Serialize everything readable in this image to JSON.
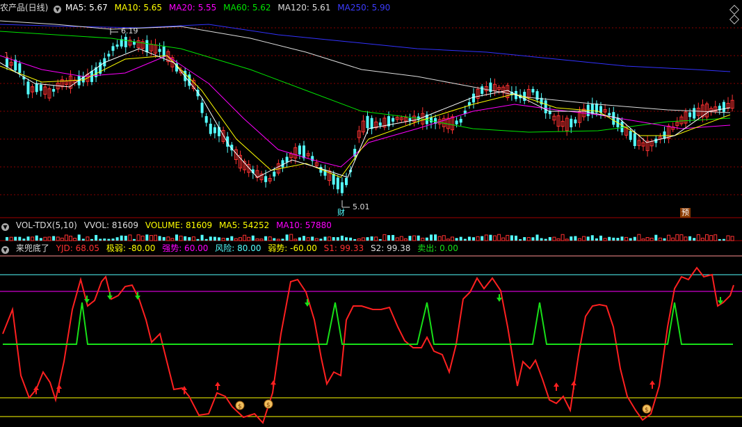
{
  "main_header": {
    "title": "农产品(日线)",
    "ma5": "MA5: 5.67",
    "ma10": "MA10: 5.65",
    "ma20": "MA20: 5.55",
    "ma60": "MA60: 5.62",
    "ma120": "MA120: 5.61",
    "ma250": "MA250: 5.90"
  },
  "main_labels": {
    "high_price": "6.19",
    "low_price": "5.01",
    "cai_badge": "财",
    "yu_badge": "预",
    "left_edge": "1"
  },
  "vol_header": {
    "name": "VOL-TDX(5,10)",
    "vvol": "VVOL: 81609",
    "volume": "VOLUME: 81609",
    "ma5": "MA5: 54252",
    "ma10": "MA10: 57880"
  },
  "ind_header": {
    "name": "来兜底了",
    "yjd": "YJD: 68.05",
    "jiruo": "极弱: -80.00",
    "qiangshi": "强势: 60.00",
    "fengxian": "风险: 80.00",
    "ruoshi": "弱势: -60.00",
    "s1": "S1: 99.33",
    "s2": "S2: 99.38",
    "maichu": "卖出: 0.00"
  },
  "colors": {
    "up": "#ff3232",
    "down": "#54ffff",
    "ma5": "#ffffff",
    "ma10": "#ffff00",
    "ma20": "#ff00ff",
    "ma60": "#00e600",
    "ma120": "#dddddd",
    "ma250": "#3232ff",
    "signal_red": "#ff2020",
    "signal_green": "#18e018"
  },
  "icons": {
    "menu": "circle-triangle-icon",
    "expand": "diamond-icon",
    "buy_bag": "money-bag-icon",
    "up_arrow": "red-up-arrow-icon",
    "down_arrow": "green-down-arrow-icon"
  }
}
